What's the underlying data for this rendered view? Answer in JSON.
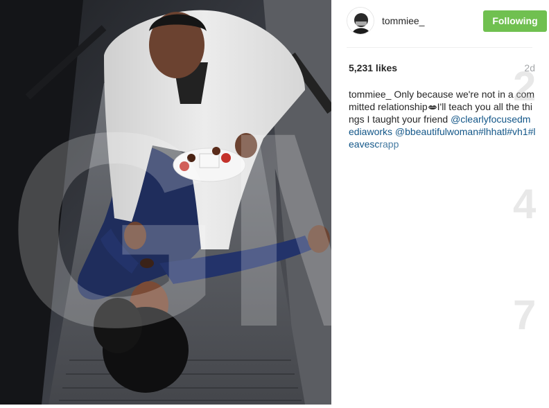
{
  "post": {
    "author": {
      "username": "tommiee_",
      "avatar_icon": "avatar-image"
    },
    "follow_button_label": "Following",
    "likes_text": "5,231 likes",
    "timestamp": "2d",
    "caption": {
      "username": "tommiee_",
      "text_before_emoji": "Only because we're not in a committed relationship",
      "emoji_icon": "kiss-lips-icon",
      "text_after_emoji": "I'll teach you all the things I taught your friend ",
      "mention_1": "@clearlyfocusedmediaworks",
      "mention_2": "@bbeautifulwoman",
      "hashtag_1": "#lhhatl",
      "hashtag_2": "#vh1",
      "hashtag_3": "#leavescrapp"
    }
  },
  "watermark": {
    "letters": "GM",
    "superscript": "2",
    "digits": [
      "4",
      "7"
    ]
  },
  "colors": {
    "following_button": "#70c050",
    "link": "#125688",
    "timestamp": "#a5a7aa"
  }
}
